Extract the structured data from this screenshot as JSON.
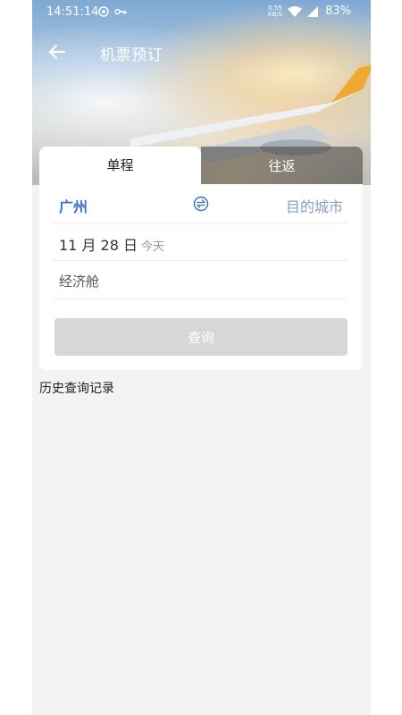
{
  "status_bar": {
    "time": "14:51:14",
    "net_speed_value": "0.55",
    "net_speed_unit": "KB/S",
    "battery": "83%"
  },
  "header": {
    "title": "机票预订"
  },
  "tabs": [
    {
      "label": "单程",
      "active": true
    },
    {
      "label": "往返",
      "active": false
    }
  ],
  "form": {
    "from_city": "广州",
    "to_city": "目的城市",
    "date": "11 月 28 日",
    "date_hint": "今天",
    "cabin_class": "经济舱",
    "search_label": "查询"
  },
  "history": {
    "title": "历史查询记录"
  },
  "colors": {
    "accent": "#3d6fc4",
    "placeholder": "#8a9fbf",
    "disabled_button": "#d7d7d7",
    "page_bg": "#f3f3f3"
  }
}
